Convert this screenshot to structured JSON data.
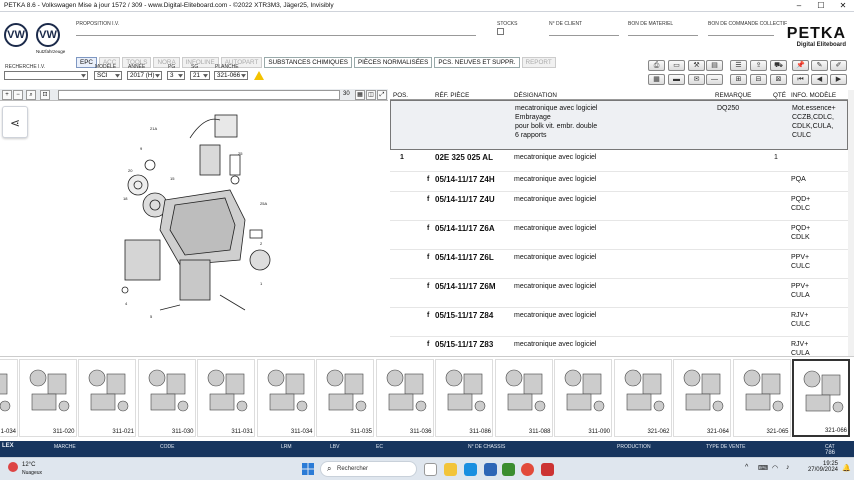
{
  "app": {
    "title": "PETKA 8.6 - Volkswagen Mise à jour 1572 / 309 - www.Digital-Eliteboard.com - ©2022 XTR3M3, Jäger25, Invisibly"
  },
  "brand": {
    "subbrand": "Nutzfahrzeuge",
    "logo_name": "PETKA",
    "logo_sub": "Digital Eliteboard"
  },
  "header": {
    "proposition_label": "PROPOSITION I.V.",
    "stocks_label": "STOCKS",
    "client_label": "N° DE CLIENT",
    "bon_materiel_label": "BON DE MATERIEL",
    "bon_commande_label": "BON DE COMMANDE COLLECTIF"
  },
  "tabs": [
    {
      "label": "EPC",
      "state": "active"
    },
    {
      "label": "ACC",
      "state": "disabled"
    },
    {
      "label": "TOOLS",
      "state": "disabled"
    },
    {
      "label": "NORA",
      "state": "disabled"
    },
    {
      "label": "INFOLINE",
      "state": "disabled"
    },
    {
      "label": "AUTOPART",
      "state": "disabled"
    },
    {
      "label": "SUBSTANCES CHIMIQUES",
      "state": "normal"
    },
    {
      "label": "PIÈCES NORMALISÉES",
      "state": "normal"
    },
    {
      "label": "PCS. NEUVES ET SUPPR.",
      "state": "normal"
    },
    {
      "label": "REPORT",
      "state": "disabled"
    }
  ],
  "selectors": {
    "recherche_label": "RECHERCHE I.V.",
    "recherche_value": "",
    "modele_label": "MODÈLE",
    "modele_value": "SCI",
    "annee_label": "ANNÉE",
    "annee_value": "2017 (H)",
    "pg_label": "PG",
    "pg_value": "3",
    "sg_label": "SG",
    "sg_value": "21",
    "planche_label": "PLANCHE",
    "planche_value": "321-066"
  },
  "image_toolbar": {
    "zoom_value": "30"
  },
  "table": {
    "headers": {
      "pos": "POS.",
      "ref": "RÉF. PIÈCE",
      "designation": "DÉSIGNATION",
      "remarque": "REMARQUE",
      "qte": "QTÉ",
      "info": "INFO. MODÈLE"
    },
    "rows": [
      {
        "pos": "",
        "prefix": "",
        "ref": "",
        "designation": "mecatronique avec logiciel\nEmbrayage\npour bolk vit. embr. double\n6 rapports",
        "remarque": "DQ250",
        "qte": "",
        "info": "Mot.essence+\nCCZB,CDLC,\nCDLK,CULA,\nCULC"
      },
      {
        "pos": "1",
        "prefix": "",
        "ref": "02E 325 025 AL",
        "designation": "mecatronique avec logiciel",
        "remarque": "",
        "qte": "1",
        "info": ""
      },
      {
        "pos": "",
        "prefix": "f",
        "ref": "05/14-11/17 Z4H",
        "designation": "mecatronique avec logiciel",
        "remarque": "",
        "qte": "",
        "info": "PQA"
      },
      {
        "pos": "",
        "prefix": "f",
        "ref": "05/14-11/17 Z4U",
        "designation": "mecatronique avec logiciel",
        "remarque": "",
        "qte": "",
        "info": "PQD+\nCDLC"
      },
      {
        "pos": "",
        "prefix": "f",
        "ref": "05/14-11/17 Z6A",
        "designation": "mecatronique avec logiciel",
        "remarque": "",
        "qte": "",
        "info": "PQD+\nCDLK"
      },
      {
        "pos": "",
        "prefix": "f",
        "ref": "05/14-11/17 Z6L",
        "designation": "mecatronique avec logiciel",
        "remarque": "",
        "qte": "",
        "info": "PPV+\nCULC"
      },
      {
        "pos": "",
        "prefix": "f",
        "ref": "05/14-11/17 Z6M",
        "designation": "mecatronique avec logiciel",
        "remarque": "",
        "qte": "",
        "info": "PPV+\nCULA"
      },
      {
        "pos": "",
        "prefix": "f",
        "ref": "05/15-11/17 Z84",
        "designation": "mecatronique avec logiciel",
        "remarque": "",
        "qte": "",
        "info": "RJV+\nCULC"
      },
      {
        "pos": "",
        "prefix": "f",
        "ref": "05/15-11/17 Z83",
        "designation": "mecatronique avec logiciel",
        "remarque": "",
        "qte": "",
        "info": "RJV+\nCULA"
      }
    ]
  },
  "thumbnails": [
    "1-034",
    "311-020",
    "311-021",
    "311-030",
    "311-031",
    "311-034",
    "311-035",
    "311-036",
    "311-086",
    "311-088",
    "311-090",
    "321-062",
    "321-064",
    "321-065",
    "321-066"
  ],
  "statusbar": {
    "marche": "MARCHE",
    "code": "CODE",
    "lrm": "LRM",
    "lbv": "LBV",
    "ec": "EC",
    "chassis": "N° DE CHASSIS",
    "production": "PRODUCTION",
    "type_vente": "TYPE DE VENTE",
    "cat": "CAT",
    "cat_value": "786"
  },
  "taskbar": {
    "weather_temp": "12°C",
    "weather_desc": "Nuageux",
    "search_placeholder": "Rechercher",
    "time": "19:25",
    "date": "27/09/2024"
  },
  "colors": {
    "statusbar_bg": "#17355e",
    "highlight_row": "#eef0f3",
    "brand_navy": "#1b2a4a"
  }
}
